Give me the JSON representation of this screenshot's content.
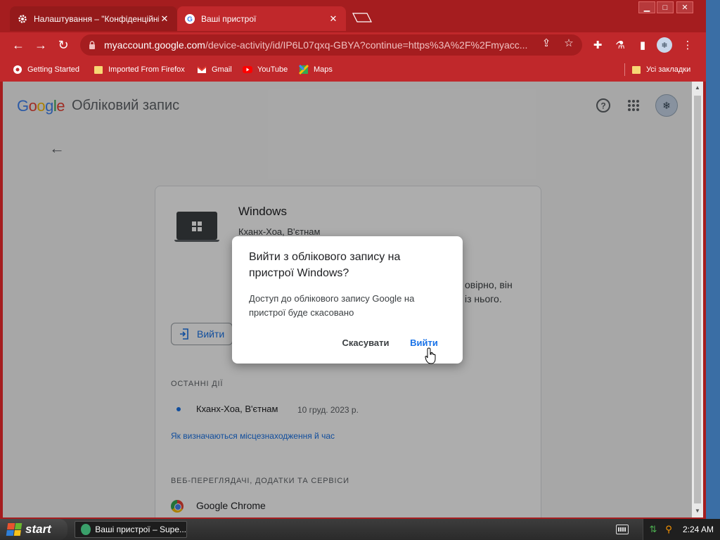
{
  "tabs": [
    {
      "title": "Налаштування – \"Конфіденційніст",
      "icon": "gear-icon"
    },
    {
      "title": "Ваші пристрої",
      "icon": "google-g-icon"
    }
  ],
  "omnibox": {
    "url_host": "myaccount.google.com",
    "url_path": "/device-activity/id/IP6L07qxq-GBYA?continue=https%3A%2F%2Fmyacc..."
  },
  "bookmarks": [
    {
      "label": "Getting Started",
      "icon": "chromium-icon"
    },
    {
      "label": "Imported From Firefox",
      "icon": "folder-icon"
    },
    {
      "label": "Gmail",
      "icon": "gmail-icon"
    },
    {
      "label": "YouTube",
      "icon": "youtube-icon"
    },
    {
      "label": "Maps",
      "icon": "maps-icon"
    }
  ],
  "all_bookmarks_label": "Усі закладки",
  "header": {
    "logo_text": "Google",
    "product": "Обліковий запис"
  },
  "device": {
    "name": "Windows",
    "location": "Кханх-Хоа, В'єтнам",
    "desc_tail_1": "овірно, він",
    "desc_tail_2": "із нього.",
    "signout_button": "Вийти"
  },
  "recent_activity": {
    "heading": "ОСТАННІ ДІЇ",
    "location": "Кханх-Хоа, В'єтнам",
    "date": "10 груд. 2023 р.",
    "link": "Як визначаються місцезнаходження й час"
  },
  "apps": {
    "heading": "ВЕБ-ПЕРЕГЛЯДАЧІ, ДОДАТКИ ТА СЕРВІСИ",
    "first_app": "Google Chrome"
  },
  "dialog": {
    "title": "Вийти з облікового запису на пристрої Windows?",
    "body": "Доступ до облікового запису Google на пристрої буде скасовано",
    "cancel": "Скасувати",
    "confirm": "Вийти"
  },
  "taskbar": {
    "start": "start",
    "task_item": "Ваші пристрої – Supe...",
    "clock": "2:24 AM"
  },
  "colors": {
    "chrome_theme": "#a51d1f",
    "toolbar": "#c0282b",
    "accent": "#1a73e8"
  }
}
